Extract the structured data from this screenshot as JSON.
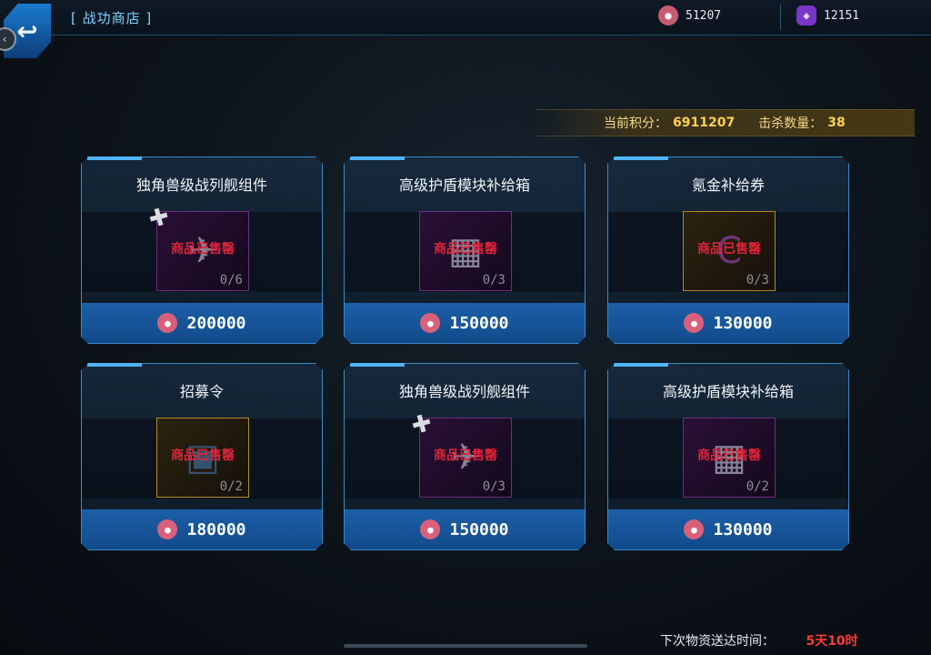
{
  "header": {
    "title": "[ 战功商店 ]",
    "currency_medal": "51207",
    "currency_gem": "12151"
  },
  "score": {
    "points_label": "当前积分：",
    "points_value": "6911207",
    "kills_label": "击杀数量：",
    "kills_value": "38"
  },
  "sold_label": "商品已售罄",
  "items": [
    {
      "name": "独角兽级战列舰组件",
      "count": "0/6",
      "price": "200000",
      "icon": "puzzle-icon",
      "frame": "purple"
    },
    {
      "name": "高级护盾模块补给箱",
      "count": "0/3",
      "price": "150000",
      "icon": "crate-icon",
      "frame": "purple"
    },
    {
      "name": "氪金补给券",
      "count": "0/3",
      "price": "130000",
      "icon": "coupon-icon",
      "frame": "gold"
    },
    {
      "name": "招募令",
      "count": "0/2",
      "price": "180000",
      "icon": "card-icon",
      "frame": "gold"
    },
    {
      "name": "独角兽级战列舰组件",
      "count": "0/3",
      "price": "150000",
      "icon": "puzzle-icon",
      "frame": "purple"
    },
    {
      "name": "高级护盾模块补给箱",
      "count": "0/2",
      "price": "130000",
      "icon": "crate-icon",
      "frame": "purple"
    }
  ],
  "footer": {
    "label": "下次物资送达时间：",
    "time": "5天10时"
  },
  "colors": {
    "accent": "#3b8bc4",
    "price_bar": "#1c5fa8",
    "sold": "#e0243a",
    "score": "#ffd24d"
  }
}
